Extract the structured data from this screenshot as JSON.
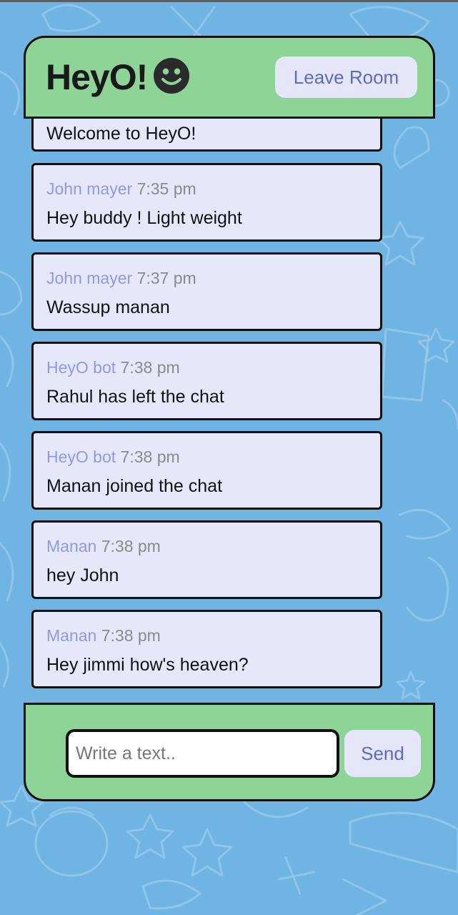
{
  "header": {
    "title": "HeyO!",
    "logo_icon": "smiley-face-icon",
    "leave_label": "Leave Room"
  },
  "messages": [
    {
      "author": "",
      "time": "",
      "text": "Welcome to HeyO!"
    },
    {
      "author": "John mayer",
      "time": "7:35 pm",
      "text": "Hey buddy ! Light weight"
    },
    {
      "author": "John mayer",
      "time": "7:37 pm",
      "text": "Wassup manan"
    },
    {
      "author": "HeyO bot",
      "time": "7:38 pm",
      "text": "Rahul has left the chat"
    },
    {
      "author": "HeyO bot",
      "time": "7:38 pm",
      "text": "Manan joined the chat"
    },
    {
      "author": "Manan",
      "time": "7:38 pm",
      "text": "hey John"
    },
    {
      "author": "Manan",
      "time": "7:38 pm",
      "text": "Hey jimmi how's heaven?"
    }
  ],
  "composer": {
    "placeholder": "Write a text..",
    "value": "",
    "send_label": "Send"
  },
  "colors": {
    "background": "#6fb4e3",
    "panel": "#8ed497",
    "message_bg": "#e7e7fb",
    "author": "#8f9ae6",
    "button_text": "#5c6bc7"
  }
}
